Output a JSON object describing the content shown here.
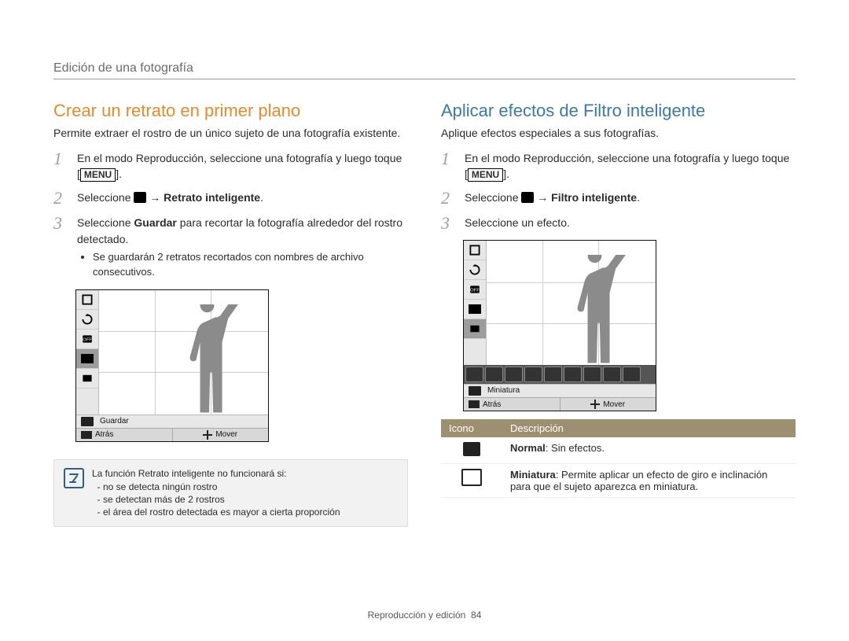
{
  "breadcrumb": "Edición de una fotografía",
  "footer": {
    "section": "Reproducción y edición",
    "page": "84"
  },
  "left": {
    "title": "Crear un retrato en primer plano",
    "lead": "Permite extraer el rostro de un único sujeto de una fotografía existente.",
    "steps": [
      {
        "num": "1",
        "text_before": "En el modo Reproducción, seleccione una fotografía y luego toque [",
        "menu_label": "MENU",
        "text_after": "]."
      },
      {
        "num": "2",
        "text_before": "Seleccione ",
        "icon": true,
        "arrow": " → ",
        "bold": "Retrato inteligente",
        "text_after": "."
      },
      {
        "num": "3",
        "text_before": "Seleccione ",
        "bold": "Guardar",
        "text_after": " para recortar la fotografía alrededor del rostro detectado.",
        "sub": [
          "Se guardarán 2 retratos recortados con nombres de archivo consecutivos."
        ]
      }
    ],
    "cam": {
      "label_row": "Guardar",
      "status_left_icon": "MENU",
      "status_left": "Atrás",
      "status_right": "Mover"
    },
    "note": {
      "lead": "La función Retrato inteligente no funcionará si:",
      "items": [
        "no se detecta ningún rostro",
        "se detectan más de 2 rostros",
        "el área del rostro detectada es mayor a cierta proporción"
      ]
    }
  },
  "right": {
    "title": "Aplicar efectos de Filtro inteligente",
    "lead": "Aplique efectos especiales a sus fotografías.",
    "steps": [
      {
        "num": "1",
        "text_before": "En el modo Reproducción, seleccione una fotografía y luego toque [",
        "menu_label": "MENU",
        "text_after": "]."
      },
      {
        "num": "2",
        "text_before": "Seleccione ",
        "icon": true,
        "arrow": " → ",
        "bold": "Filtro inteligente",
        "text_after": "."
      },
      {
        "num": "3",
        "text_before": "Seleccione un efecto."
      }
    ],
    "cam": {
      "label_row": "Miniatura",
      "status_left_icon": "MENU",
      "status_left": "Atrás",
      "status_right": "Mover"
    },
    "table": {
      "head": {
        "c1": "Icono",
        "c2": "Descripción"
      },
      "rows": [
        {
          "bold": "Normal",
          "desc": ": Sin efectos."
        },
        {
          "bold": "Miniatura",
          "desc": ": Permite aplicar un efecto de giro e inclinación para que el sujeto aparezca en miniatura."
        }
      ]
    }
  }
}
